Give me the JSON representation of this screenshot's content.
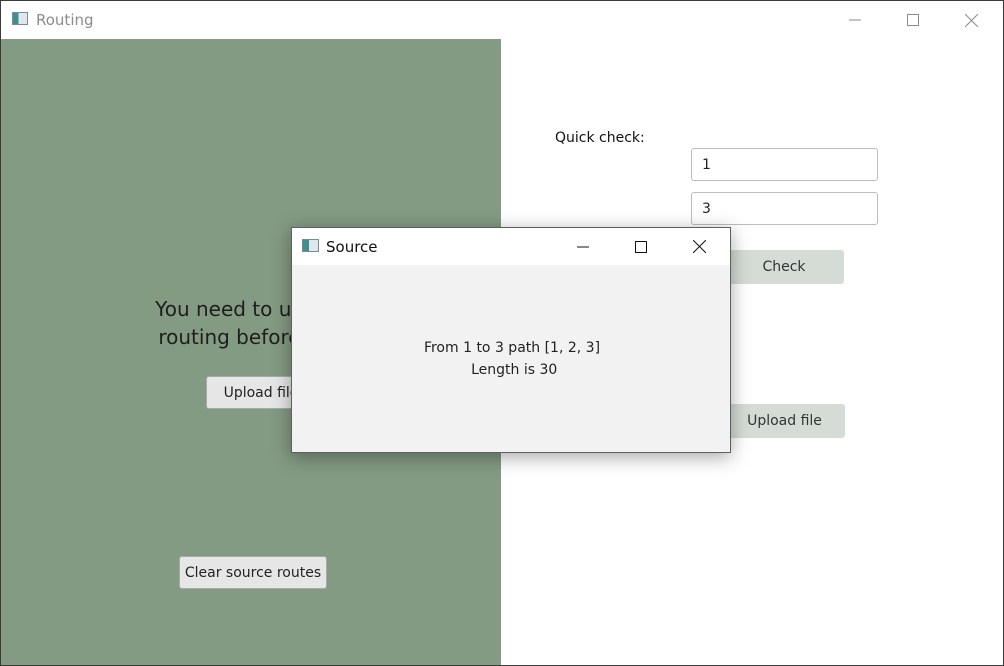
{
  "window": {
    "title": "Routing",
    "controls": {
      "minimize": "minimize-icon",
      "maximize": "maximize-icon",
      "close": "close-icon"
    }
  },
  "left_panel": {
    "background": "#839a83",
    "notice": "You need to upload\nrouting before you",
    "upload_button": "Upload file",
    "clear_button": "Clear source routes"
  },
  "right_panel": {
    "quick_check_label": "Quick check:",
    "from_field_value": "1",
    "to_field_value": "3",
    "check_button": "Check",
    "upload_button": "Upload file"
  },
  "dialog": {
    "title": "Source",
    "message": "From 1 to 3 path [1, 2, 3]\n Length is 30"
  }
}
